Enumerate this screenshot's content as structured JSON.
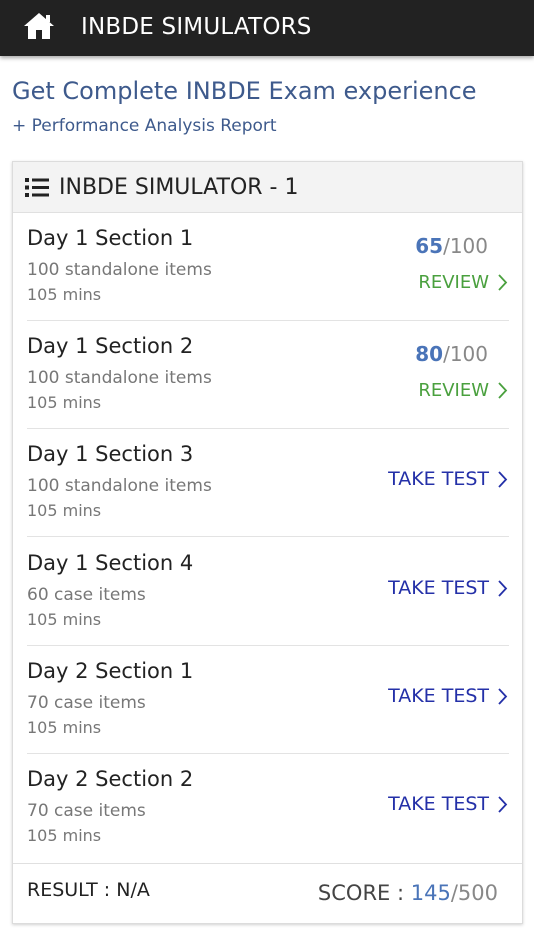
{
  "topbar": {
    "title": "INBDE SIMULATORS",
    "home_icon": "home-icon",
    "background": "#222222"
  },
  "promo": {
    "title": "Get Complete INBDE Exam experience",
    "subtitle": "+ Performance Analysis Report"
  },
  "simulator": {
    "title": "INBDE SIMULATOR - 1",
    "header_icon": "list-icon",
    "sections": [
      {
        "title": "Day 1 Section 1",
        "items": "100 standalone items",
        "duration": "105 mins",
        "score": "65",
        "score_max": "/100",
        "action": "REVIEW"
      },
      {
        "title": "Day 1 Section 2",
        "items": "100 standalone items",
        "duration": "105 mins",
        "score": "80",
        "score_max": "/100",
        "action": "REVIEW"
      },
      {
        "title": "Day 1 Section 3",
        "items": "100 standalone items",
        "duration": "105 mins",
        "action": "TAKE TEST"
      },
      {
        "title": "Day 1 Section 4",
        "items": "60 case items",
        "duration": "105 mins",
        "action": "TAKE TEST"
      },
      {
        "title": "Day 2 Section 1",
        "items": "70 case items",
        "duration": "105 mins",
        "action": "TAKE TEST"
      },
      {
        "title": "Day 2 Section 2",
        "items": "70 case items",
        "duration": "105 mins",
        "action": "TAKE TEST"
      }
    ],
    "result_label": "RESULT : N/A",
    "score_label": "SCORE : ",
    "total_score": "145",
    "total_max": "/500"
  },
  "colors": {
    "score": "#4a74b8",
    "review": "#4aa03e",
    "take_test": "#2430a8",
    "promo": "#3e5a8c"
  }
}
